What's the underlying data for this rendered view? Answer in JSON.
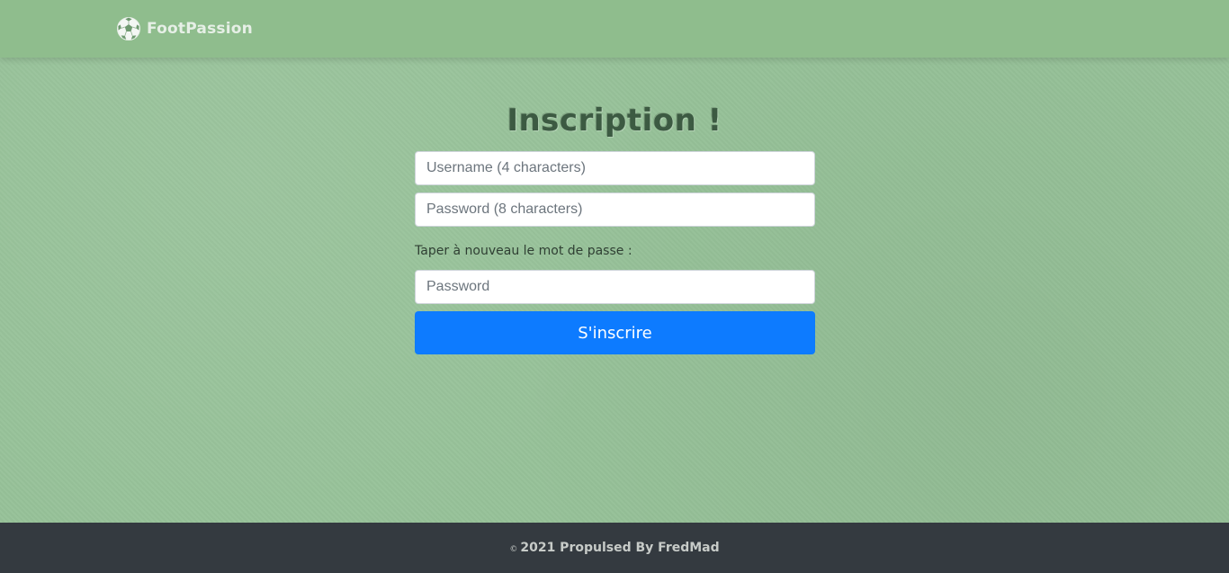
{
  "header": {
    "brand_icon": "soccer-ball-icon",
    "brand_name": "FootPassion"
  },
  "main": {
    "title": "Inscription !",
    "form": {
      "username_placeholder": "Username (4 characters)",
      "username_value": "",
      "password_placeholder": "Password (8 characters)",
      "password_value": "",
      "repeat_label": "Taper à nouveau le mot de passe :",
      "confirm_placeholder": "Password",
      "confirm_value": "",
      "submit_label": "S'inscrire"
    }
  },
  "footer": {
    "copyright_symbol": "©",
    "text": "2021 Propulsed By FredMad"
  },
  "colors": {
    "background": "#97c299",
    "navbar": "#8fbd8d",
    "primary_button": "#0d7bff",
    "footer": "#343a40"
  }
}
